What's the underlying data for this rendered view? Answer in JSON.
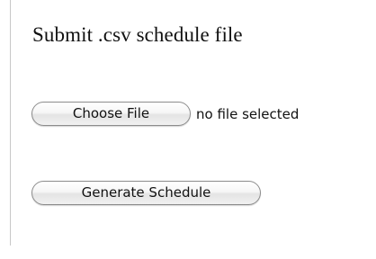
{
  "form": {
    "title": "Submit .csv schedule file",
    "choose_file_label": "Choose File",
    "file_status": "no file selected",
    "generate_label": "Generate Schedule"
  }
}
